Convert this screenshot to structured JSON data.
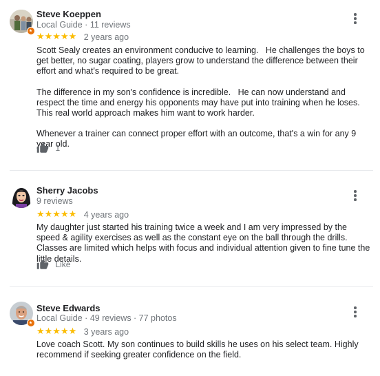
{
  "reviews": [
    {
      "name": "Steve Koeppen",
      "meta": "Local Guide · 11 reviews",
      "stars": "★★★★★",
      "rating": 5,
      "date": "2 years ago",
      "paragraphs": [
        "Scott Sealy creates an environment conducive to learning.   He challenges the boys to get better, no sugar coating, players grow to understand the difference between their effort and what's required to be great.",
        "The difference in my son's confidence is incredible.   He can now understand and  respect the time and energy his opponents may have put into training when he loses.   This real world approach makes him want to work harder.",
        "Whenever a trainer can connect proper effort with an outcome, that's a win for any 9 year old."
      ],
      "like_label": "1",
      "avatar_icon": "profile-photo-icon",
      "badge_icon": "local-guide-badge-icon"
    },
    {
      "name": "Sherry Jacobs",
      "meta": "9 reviews",
      "stars": "★★★★★",
      "rating": 5,
      "date": "4 years ago",
      "paragraphs": [
        "My daughter just started his training twice a week and I am very impressed by the speed & agility exercises as well as the constant eye on the ball through the drills. Classes are limited which helps with focus and individual attention given to fine tune the little details."
      ],
      "like_label": "Like",
      "avatar_icon": "profile-photo-icon"
    },
    {
      "name": "Steve Edwards",
      "meta": "Local Guide · 49 reviews · 77 photos",
      "stars": "★★★★★",
      "rating": 5,
      "date": "3 years ago",
      "paragraphs": [
        "Love coach Scott. My son continues to build skills he uses on his select team. Highly recommend if seeking greater confidence on the field."
      ],
      "avatar_icon": "profile-photo-icon",
      "badge_icon": "local-guide-badge-icon"
    }
  ],
  "colors": {
    "star": "#fbbc04",
    "muted_text": "#70757a",
    "body_text": "#202124",
    "badge": "#e8710a",
    "divider": "#e8eaed"
  },
  "icons": {
    "more": "more-vert-icon",
    "like": "thumbs-up-icon"
  }
}
